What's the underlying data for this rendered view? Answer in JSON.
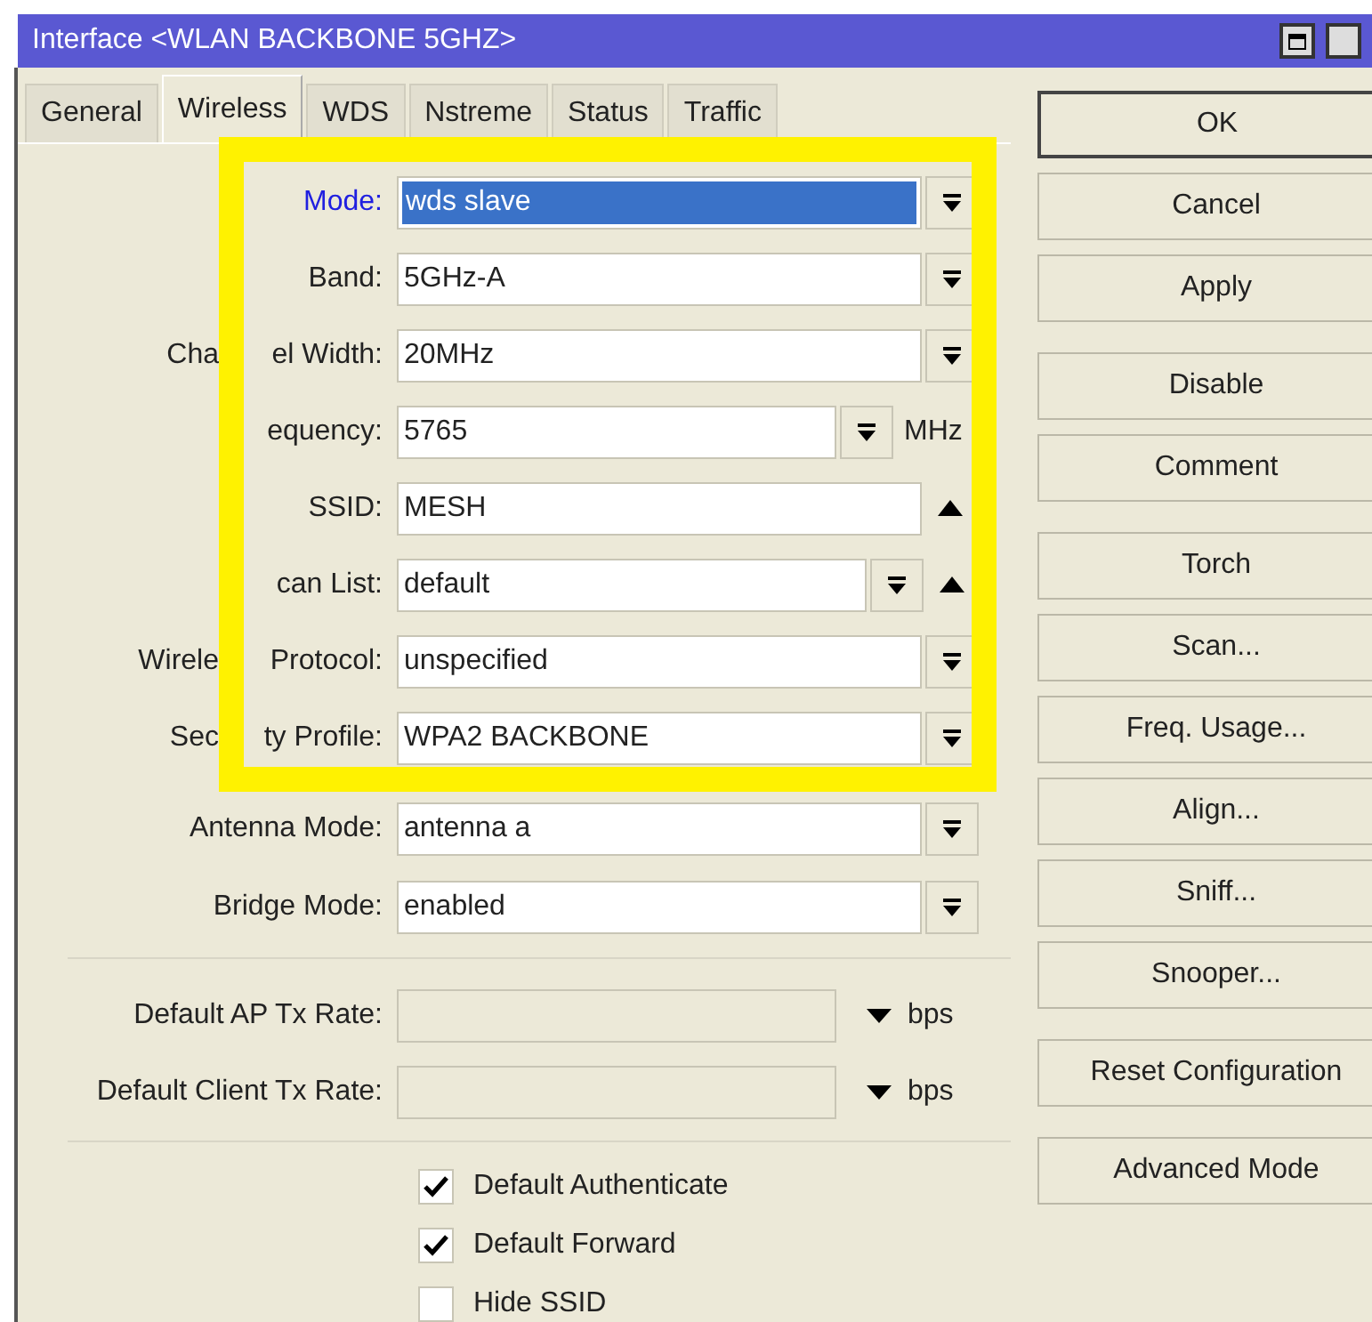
{
  "window": {
    "title": "Interface <WLAN BACKBONE 5GHZ>"
  },
  "tabs": [
    {
      "label": "General",
      "selected": false
    },
    {
      "label": "Wireless",
      "selected": true
    },
    {
      "label": "WDS",
      "selected": false
    },
    {
      "label": "Nstreme",
      "selected": false
    },
    {
      "label": "Status",
      "selected": false
    },
    {
      "label": "Traffic",
      "selected": false
    }
  ],
  "settings": [
    {
      "kind": "select",
      "label": "Mode:",
      "value": "wds slave",
      "focused": true
    },
    {
      "kind": "select",
      "label": "Band:",
      "value": "5GHz-A",
      "focused": false
    },
    {
      "kind": "select",
      "label_left": "Cha",
      "label": "el Width:",
      "value": "20MHz",
      "focused": false
    },
    {
      "kind": "select",
      "label": "equency:",
      "value": "5765",
      "unit": "MHz",
      "focused": false
    },
    {
      "kind": "text_collapse",
      "label": "SSID:",
      "value": "MESH",
      "focused": false
    },
    {
      "kind": "select_collapse",
      "label": "can List:",
      "value": "default",
      "focused": false
    },
    {
      "kind": "select",
      "label_left": "Wirele",
      "label": "Protocol:",
      "value": "unspecified",
      "focused": false
    },
    {
      "kind": "select",
      "label_left": "Sec",
      "label": "ty Profile:",
      "value": "WPA2 BACKBONE",
      "focused": false
    },
    {
      "kind": "select",
      "label": "Antenna Mode:",
      "value": "antenna a",
      "focused": false,
      "full": true
    },
    {
      "kind": "select",
      "label": "Bridge Mode:",
      "value": "enabled",
      "focused": false,
      "full": true
    }
  ],
  "rates": [
    {
      "label": "Default AP Tx Rate:",
      "unit": "bps"
    },
    {
      "label": "Default Client Tx Rate:",
      "unit": "bps"
    }
  ],
  "checkboxes": [
    {
      "label": "Default Authenticate",
      "checked": true
    },
    {
      "label": "Default Forward",
      "checked": true
    },
    {
      "label": "Hide SSID",
      "checked": false
    }
  ],
  "button_groups": [
    {
      "buttons": [
        {
          "label": "OK",
          "default": true
        },
        {
          "label": "Cancel",
          "default": false
        },
        {
          "label": "Apply",
          "default": false
        }
      ]
    },
    {
      "buttons": [
        {
          "label": "Disable",
          "default": false
        },
        {
          "label": "Comment",
          "default": false
        }
      ]
    },
    {
      "buttons": [
        {
          "label": "Torch",
          "default": false
        },
        {
          "label": "Scan...",
          "default": false
        },
        {
          "label": "Freq. Usage...",
          "default": false
        },
        {
          "label": "Align...",
          "default": false
        },
        {
          "label": "Sniff...",
          "default": false
        },
        {
          "label": "Snooper...",
          "default": false
        }
      ]
    },
    {
      "buttons": [
        {
          "label": "Reset Configuration",
          "default": false
        }
      ]
    },
    {
      "buttons": [
        {
          "label": "Advanced Mode",
          "default": false
        }
      ]
    }
  ]
}
